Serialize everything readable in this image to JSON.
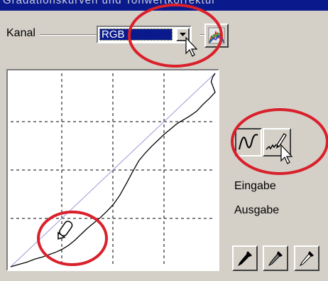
{
  "window": {
    "title": "Gradationskurven und Tonwertkorrektur"
  },
  "channel": {
    "label": "Kanal",
    "selected": "RGB",
    "dropdown_icon": "chevron-down-icon",
    "histogram_icon": "rgb-histogram-icon"
  },
  "curve_editor": {
    "grid_divisions": 4,
    "diagonal_color": "#9a9ad8",
    "curve_color": "#000000",
    "curve": [
      [
        0,
        0
      ],
      [
        10,
        3
      ],
      [
        20,
        6
      ],
      [
        30,
        10
      ],
      [
        40,
        13
      ],
      [
        48,
        16
      ],
      [
        56,
        19
      ],
      [
        64,
        23
      ],
      [
        72,
        28
      ],
      [
        80,
        35
      ],
      [
        88,
        43
      ],
      [
        96,
        51
      ],
      [
        104,
        58
      ],
      [
        112,
        65
      ],
      [
        120,
        73
      ],
      [
        128,
        82
      ],
      [
        136,
        94
      ],
      [
        144,
        109
      ],
      [
        152,
        125
      ],
      [
        160,
        140
      ],
      [
        168,
        150
      ],
      [
        176,
        159
      ],
      [
        184,
        167
      ],
      [
        192,
        175
      ],
      [
        200,
        182
      ],
      [
        208,
        189
      ],
      [
        216,
        194
      ],
      [
        224,
        199
      ],
      [
        232,
        205
      ],
      [
        240,
        214
      ],
      [
        248,
        222
      ],
      [
        255,
        230
      ]
    ],
    "curve_top": [
      [
        250,
        244
      ],
      [
        252,
        250
      ],
      [
        255,
        255
      ]
    ]
  },
  "tools": {
    "smooth_curve_icon": "smooth-curve-icon",
    "freehand_icon": "pencil-freehand-icon"
  },
  "readouts": {
    "input_label": "Eingabe",
    "output_label": "Ausgabe"
  },
  "eyedroppers": [
    {
      "name": "black-point",
      "icon": "black-eyedropper-icon"
    },
    {
      "name": "gray-point",
      "icon": "gray-eyedropper-icon"
    },
    {
      "name": "white-point",
      "icon": "white-eyedropper-icon"
    }
  ],
  "annotation_color": "#d9202b"
}
